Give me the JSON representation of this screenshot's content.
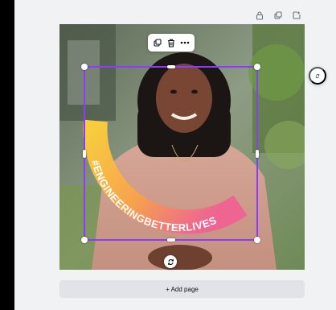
{
  "add_page_label": "+ Add page",
  "graphic": {
    "hashtag_text": "#ENGINEERINGBETTERLIVES"
  },
  "icons": {
    "page_toolbar": [
      "lock-icon",
      "duplicate-page-icon",
      "add-page-icon"
    ],
    "context_toolbar": [
      "copy-icon",
      "trash-icon",
      "more-icon"
    ],
    "rotate": "rotate-icon",
    "refresh": "refresh-icon"
  },
  "colors": {
    "workspace_bg": "#f1f2f4",
    "selection_accent": "#8b3dff",
    "add_page_bg": "#e1e3e8",
    "arc_gradient_start": "#ffd23a",
    "arc_gradient_end": "#f06292",
    "hashtag_text": "#ffffff"
  }
}
